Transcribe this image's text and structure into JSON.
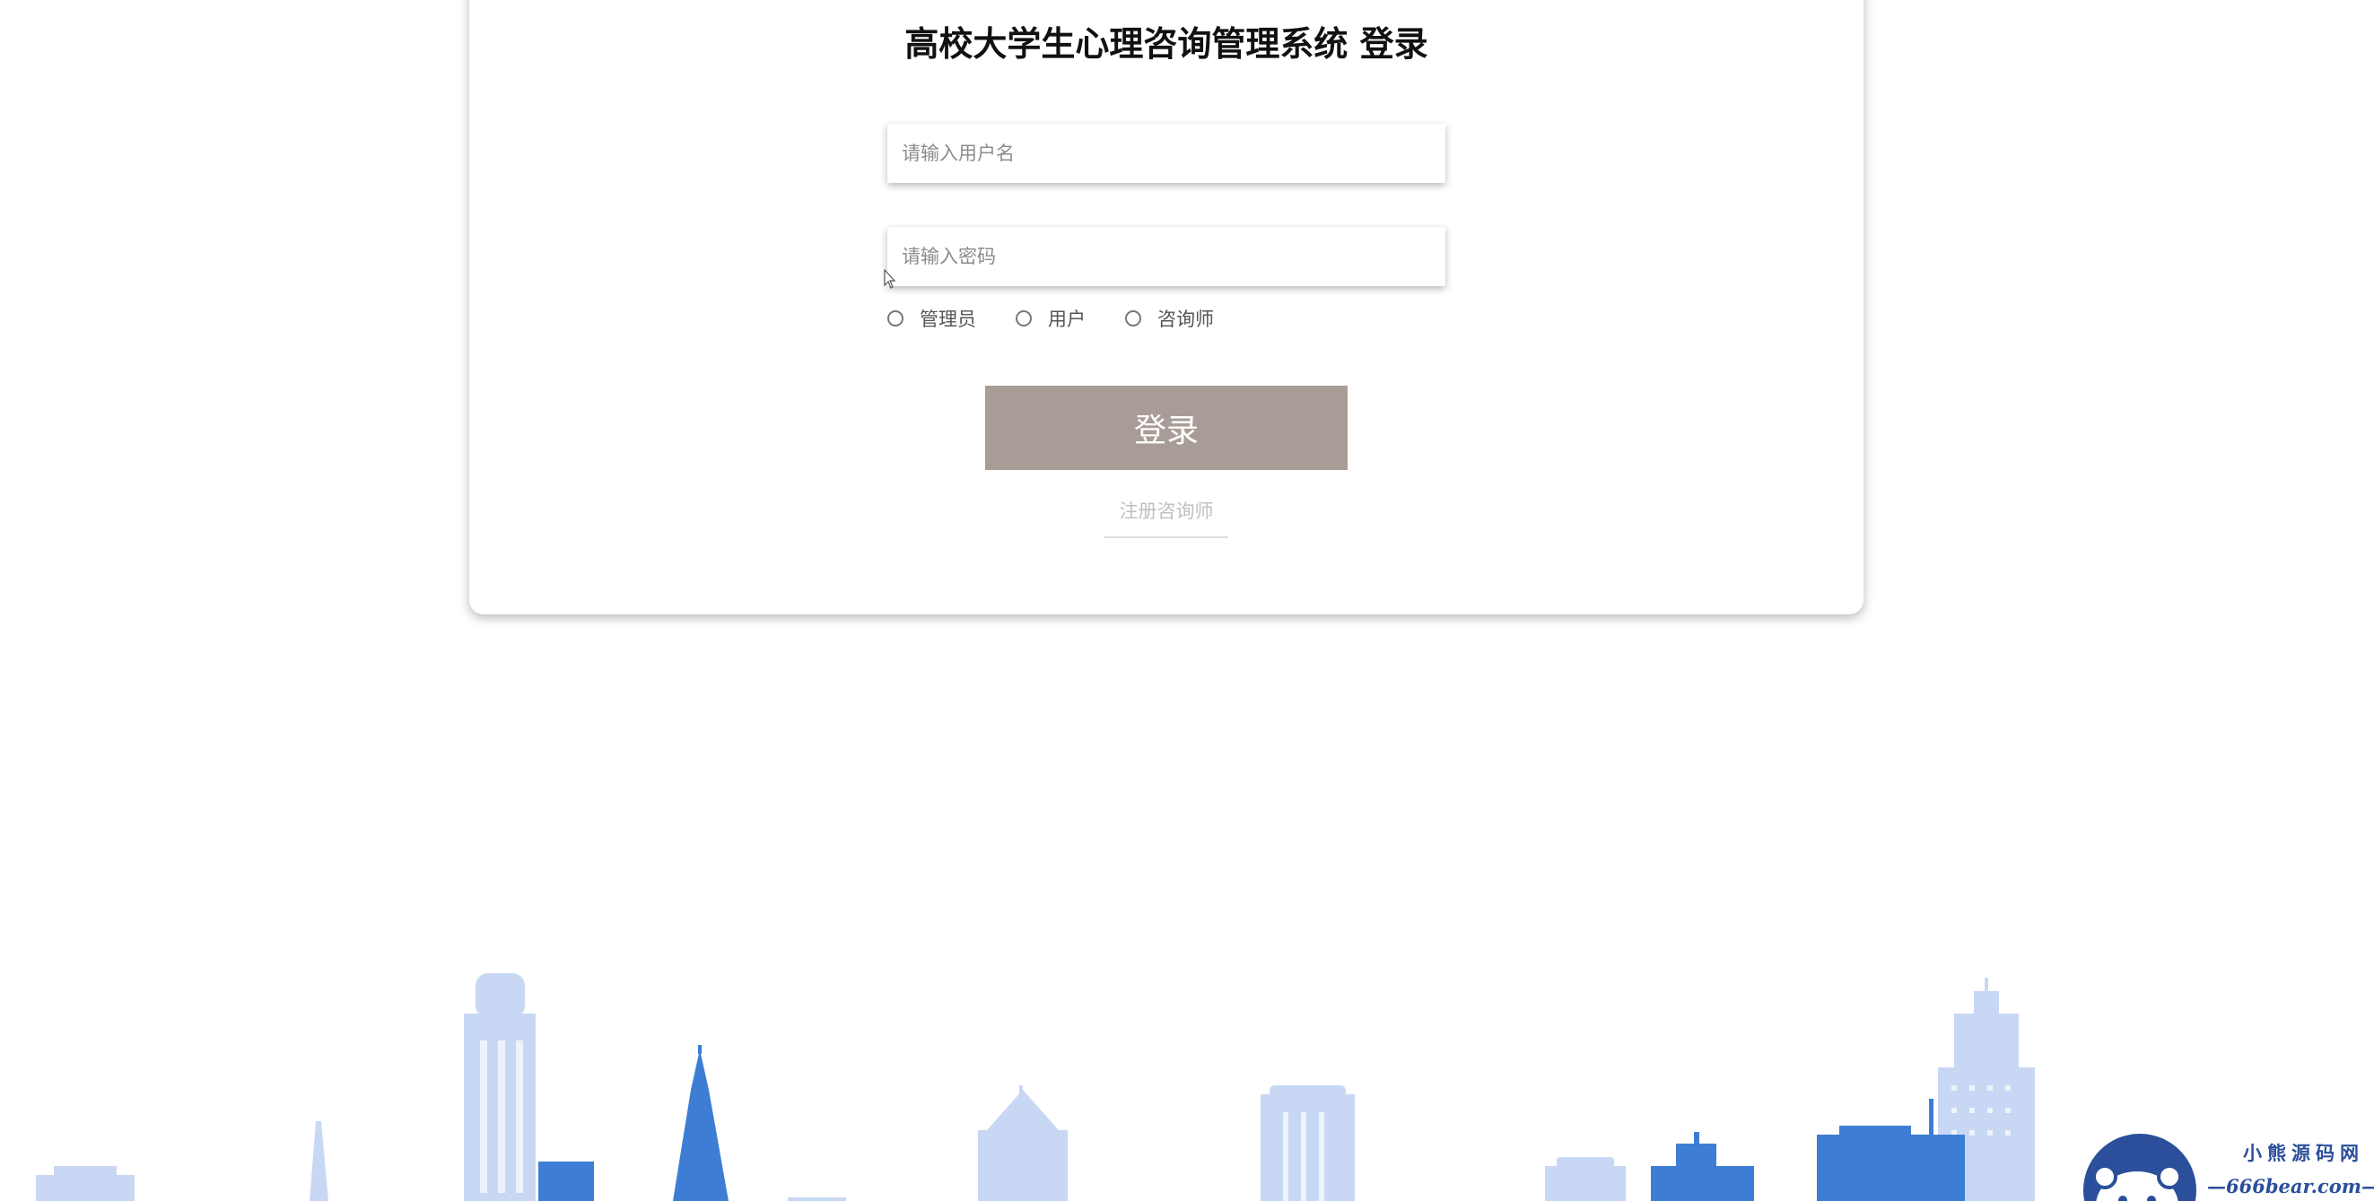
{
  "login": {
    "title": "高校大学生心理咨询管理系统 登录",
    "username_placeholder": "请输入用户名",
    "password_placeholder": "请输入密码",
    "roles": [
      {
        "label": "管理员"
      },
      {
        "label": "用户"
      },
      {
        "label": "咨询师"
      }
    ],
    "login_button": "登录",
    "register_link": "注册咨询师"
  },
  "watermark": {
    "name": "小熊源码网",
    "url": "—666bear.com—"
  },
  "colors": {
    "button": "#a89d96",
    "skyline_light": "#c5d6f3",
    "skyline_dark": "#3f7fd3"
  }
}
